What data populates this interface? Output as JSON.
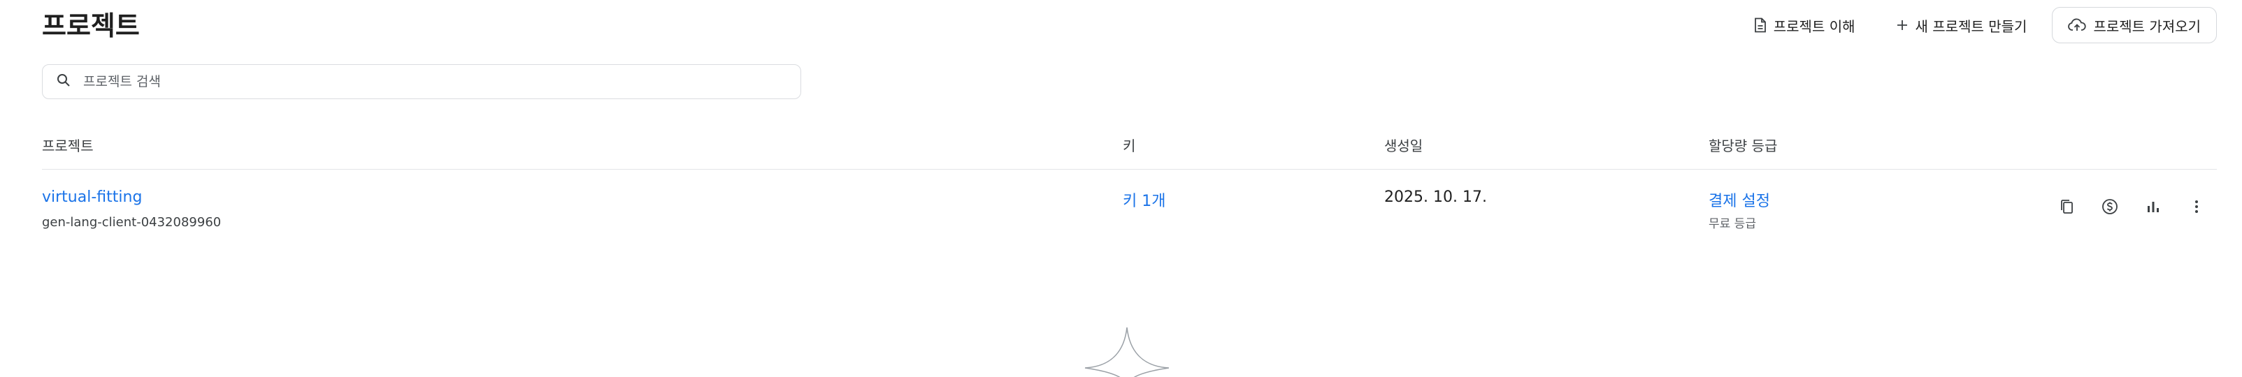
{
  "page": {
    "title": "프로젝트"
  },
  "actions": {
    "understand": {
      "label": "프로젝트 이해",
      "icon": "document-icon"
    },
    "create": {
      "label": "새 프로젝트 만들기",
      "icon": "plus-icon"
    },
    "import": {
      "label": "프로젝트 가져오기",
      "icon": "cloud-upload-icon"
    }
  },
  "search": {
    "placeholder": "프로젝트 검색",
    "value": ""
  },
  "table": {
    "headers": {
      "project": "프로젝트",
      "key": "키",
      "created": "생성일",
      "quota": "할당량 등급"
    },
    "rows": [
      {
        "name": "virtual-fitting",
        "id": "gen-lang-client-0432089960",
        "keys": "키 1개",
        "created": "2025. 10. 17.",
        "billing": "결제 설정",
        "tier": "무료 등급"
      }
    ]
  },
  "row_actions": [
    "copy-icon",
    "dollar-icon",
    "bar-chart-icon",
    "more-vert-icon"
  ]
}
